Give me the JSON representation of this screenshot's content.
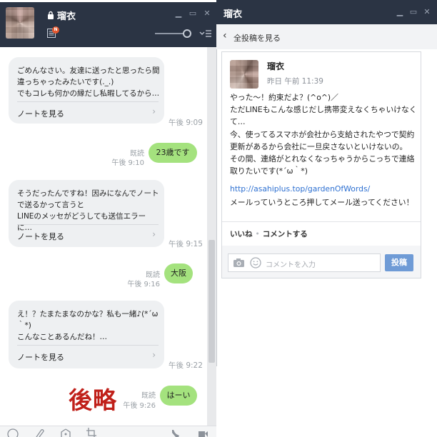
{
  "colors": {
    "header_bg": "#2b3444",
    "my_bubble": "#a4e27e",
    "note_card_bg": "#eef0f2",
    "link": "#2c6fd1",
    "post_button": "#6f9bd6",
    "annotation": "#c0201a"
  },
  "chat": {
    "contact_name": "瑠衣",
    "notes": [
      {
        "text": "ごめんなさい。友達に送ったと思ったら間違っちゃったみたいです(._.)\nでもコレも何かの縁だし私暇してるから…",
        "more_label": "ノートを見る",
        "time": "午後 9:09"
      },
      {
        "text": "そうだったんですね！因みになんでノートで送るかって言うと\nLINEのメッセがどうしても送信エラーに…",
        "more_label": "ノートを見る",
        "time": "午後 9:15"
      },
      {
        "text": "え！？たまたまなのかな？私も一緒♪(*´ω｀*)\nこんなことあるんだね！…",
        "more_label": "ノートを見る",
        "time": "午後 9:22"
      }
    ],
    "my_messages": [
      {
        "text": "23歳です",
        "read": "既読",
        "time": "午後 9:10"
      },
      {
        "text": "大阪",
        "read": "既読",
        "time": "午後 9:16"
      },
      {
        "text": "はーい",
        "read": "既読",
        "time": "午後 9:26"
      }
    ],
    "annotation": "後略"
  },
  "post": {
    "window_title": "瑠衣",
    "back_label": "全投稿を見る",
    "author": "瑠衣",
    "timestamp": "昨日 午前 11:39",
    "body": "やった〜！約束だよ？(^o^)／\nただLINEもこんな感じだし携帯変えなくちゃいけなくて…\n今、使ってるスマホが会社から支給されたやつで契約更新があるから会社に一旦戻さないといけないの。\nその間、連絡がとれなくなっちゃうからこっちで連絡取りたいです(*´ω｀*)",
    "link": "http://asahiplus.top/gardenOfWords/",
    "body_after": "メールっていうところ押してメール送ってください！",
    "like_label": "いいね",
    "comment_label": "コメントする",
    "comment_placeholder": "コメントを入力",
    "submit_label": "投稿"
  }
}
